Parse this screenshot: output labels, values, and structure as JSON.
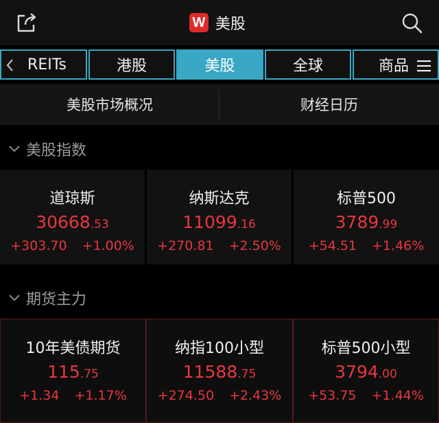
{
  "header": {
    "logo_letter": "W",
    "title": "美股",
    "share_icon": "share-icon",
    "search_icon": "search-icon"
  },
  "tabs": [
    {
      "label": "REITs",
      "active": false
    },
    {
      "label": "港股",
      "active": false
    },
    {
      "label": "美股",
      "active": true
    },
    {
      "label": "全球",
      "active": false
    },
    {
      "label": "商品",
      "active": false
    }
  ],
  "section_links": {
    "overview": "美股市场概况",
    "calendar": "财经日历"
  },
  "indices": {
    "title": "美股指数",
    "items": [
      {
        "name": "道琼斯",
        "price_int": "30668",
        "price_dec": ".53",
        "change": "+303.70",
        "pct": "+1.00%"
      },
      {
        "name": "纳斯达克",
        "price_int": "11099",
        "price_dec": ".16",
        "change": "+270.81",
        "pct": "+2.50%"
      },
      {
        "name": "标普500",
        "price_int": "3789",
        "price_dec": ".99",
        "change": "+54.51",
        "pct": "+1.46%"
      }
    ]
  },
  "futures": {
    "title": "期货主力",
    "items": [
      {
        "name": "10年美债期货",
        "price_int": "115",
        "price_dec": ".75",
        "change": "+1.34",
        "pct": "+1.17%"
      },
      {
        "name": "纳指100小型",
        "price_int": "11588",
        "price_dec": ".75",
        "change": "+274.50",
        "pct": "+2.43%"
      },
      {
        "name": "标普500小型",
        "price_int": "3794",
        "price_dec": ".00",
        "change": "+53.75",
        "pct": "+1.44%"
      }
    ]
  },
  "colors": {
    "accent": "#3aa7c4",
    "up": "#e8373c",
    "brand": "#e02a2a"
  }
}
